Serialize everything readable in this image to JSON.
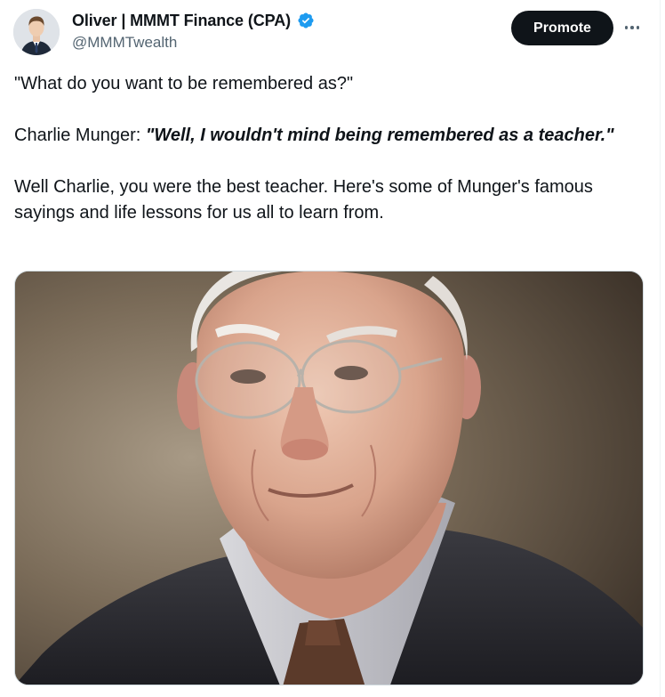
{
  "post": {
    "author": {
      "display_name": "Oliver | MMMT Finance (CPA)",
      "handle": "@MMMTwealth",
      "verified": true,
      "avatar_icon": "user-avatar"
    },
    "actions": {
      "promote_label": "Promote",
      "more_icon": "ellipsis-icon"
    },
    "text": {
      "line1": "\"What do you want to be remembered as?\"",
      "line2_prefix": "Charlie Munger: ",
      "line2_quote": "\"Well, I wouldn't mind being remembered as a teacher.\"",
      "line3": "Well Charlie, you were the best teacher. Here's some of Munger's famous sayings and life lessons for us all to learn from."
    },
    "media": {
      "type": "image",
      "subject": "portrait-painting"
    }
  },
  "colors": {
    "text": "#0f1419",
    "secondary_text": "#536471",
    "verified_blue": "#1d9bf0",
    "button_dark": "#0f1419"
  }
}
